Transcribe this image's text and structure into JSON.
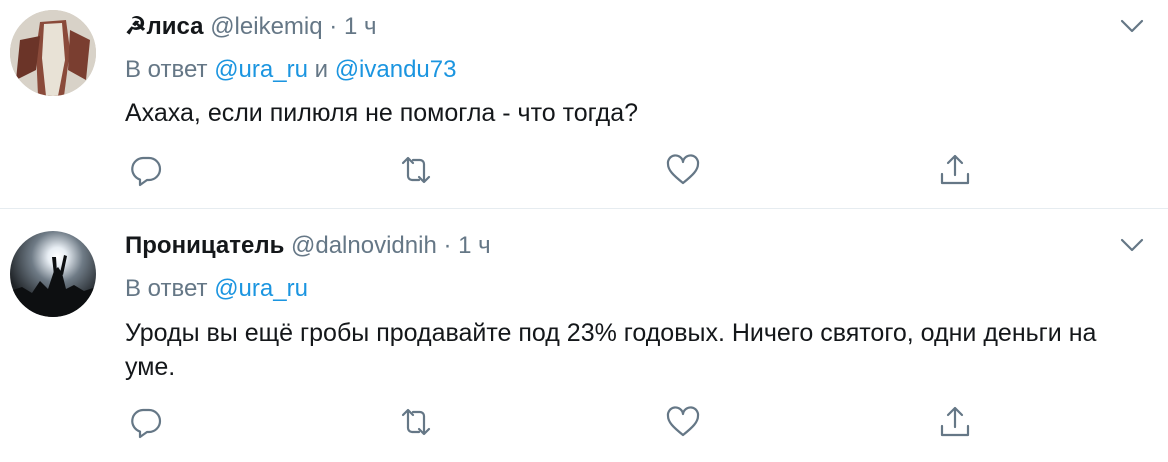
{
  "tweets": [
    {
      "name": "☭лиса",
      "handle": "@leikemiq",
      "dot": "·",
      "time": "1 ч",
      "reply_prefix": "В ответ",
      "mentions": [
        "@ura_ru",
        "@ivandu73"
      ],
      "mention_joiner": "и",
      "text": "Ахаха, если пилюля не помогла - что тогда?"
    },
    {
      "name": "Проницатель",
      "handle": "@dalnovidnih",
      "dot": "·",
      "time": "1 ч",
      "reply_prefix": "В ответ",
      "mentions": [
        "@ura_ru"
      ],
      "text": "Уроды вы ещё гробы продавайте под 23% годовых. Ничего святого, одни деньги на уме."
    }
  ],
  "icons": [
    "chevron-down-icon",
    "reply-icon",
    "retweet-icon",
    "like-icon",
    "share-icon"
  ],
  "colors": {
    "text": "#14171a",
    "secondary": "#657786",
    "link": "#1b95e0",
    "divider": "#e6ecf0"
  }
}
